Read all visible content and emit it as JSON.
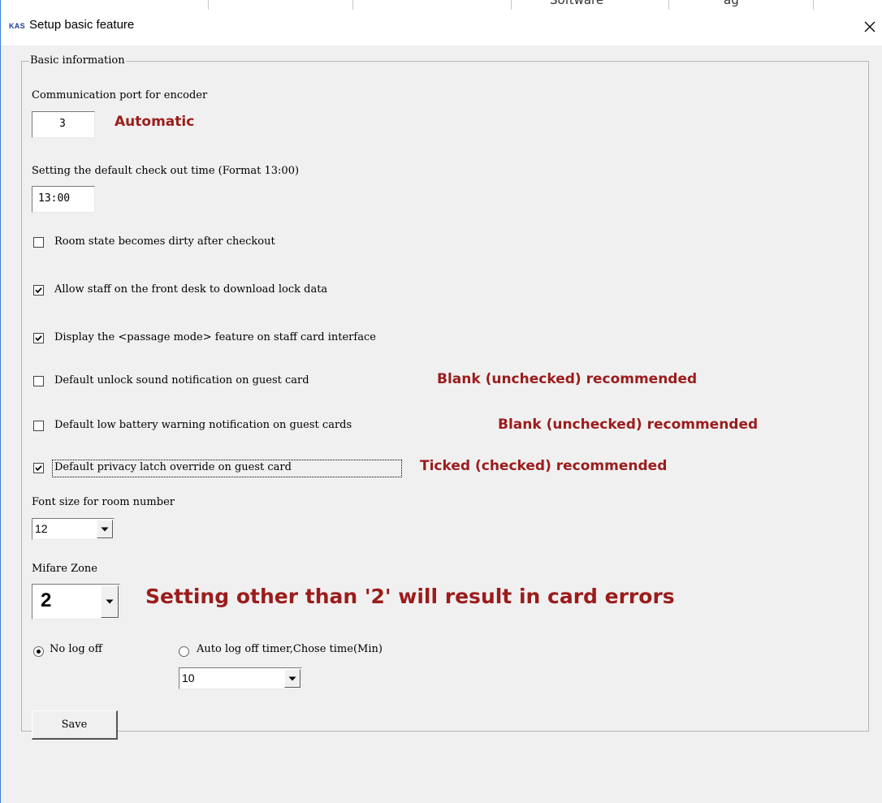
{
  "window": {
    "app_icon_text": "KAS",
    "title": "Setup basic feature",
    "close_icon": "close-icon",
    "top_strip_fragments": [
      "Software",
      "ag"
    ]
  },
  "group": {
    "legend": "Basic information"
  },
  "encoder_port": {
    "label": "Communication port for encoder",
    "value": "3",
    "annotation": "Automatic"
  },
  "checkout_time": {
    "label": "Setting the default check out time (Format 13:00)",
    "value": "13:00"
  },
  "checkboxes": [
    {
      "label": "Room state becomes dirty after checkout",
      "checked": false,
      "annotation": ""
    },
    {
      "label": "Allow staff on the front desk to download lock data",
      "checked": true,
      "annotation": ""
    },
    {
      "label": "Display the <passage mode> feature on staff card interface",
      "checked": true,
      "annotation": ""
    },
    {
      "label": "Default unlock sound notification on guest card",
      "checked": false,
      "annotation": "Blank (unchecked) recommended"
    },
    {
      "label": "Default low battery warning notification on guest cards",
      "checked": false,
      "annotation": "Blank (unchecked) recommended"
    },
    {
      "label": "Default privacy latch override on guest card",
      "checked": true,
      "annotation": "Ticked (checked) recommended"
    }
  ],
  "font_size": {
    "label": "Font size for room number",
    "value": "12"
  },
  "mifare_zone": {
    "label": "Mifare Zone",
    "value": "2",
    "annotation": "Setting other than '2' will result in card errors"
  },
  "logoff": {
    "no_logoff_label": "No log off",
    "no_logoff_selected": true,
    "auto_logoff_label": "Auto log off timer,Chose time(Min)",
    "auto_logoff_selected": false,
    "timer_value": "10"
  },
  "save_label": "Save",
  "colors": {
    "annotation": "#9b1c1c",
    "window_border": "#3c7fd6",
    "app_icon": "#1c3f94"
  }
}
